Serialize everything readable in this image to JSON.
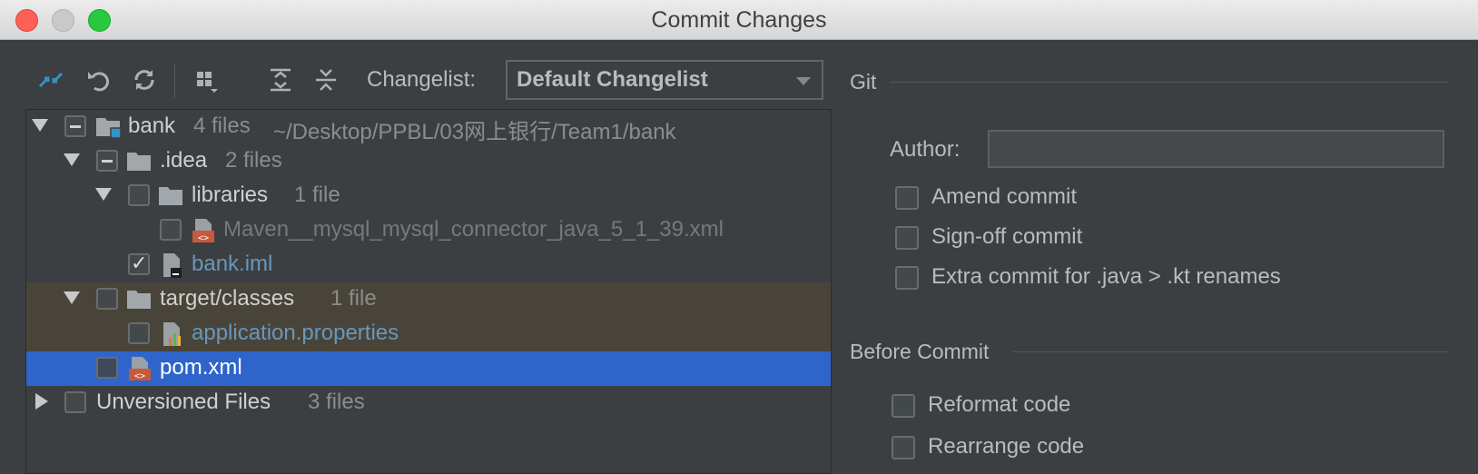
{
  "window": {
    "title": "Commit Changes"
  },
  "toolbar": {
    "icons": [
      "diff-arrows-icon",
      "undo-icon",
      "refresh-icon",
      "group-by-icon",
      "expand-all-icon",
      "collapse-all-icon"
    ],
    "changelist_label": "Changelist:",
    "changelist_value": "Default Changelist"
  },
  "tree": {
    "rows": [
      {
        "name": "bank",
        "count": "4 files",
        "path": "~/Desktop/PPBL/03网上银行/Team1/bank"
      },
      {
        "name": ".idea",
        "count": "2 files"
      },
      {
        "name": "libraries",
        "count": "1 file"
      },
      {
        "name": "Maven__mysql_mysql_connector_java_5_1_39.xml"
      },
      {
        "name": "bank.iml"
      },
      {
        "name": "target/classes",
        "count": "1 file"
      },
      {
        "name": "application.properties"
      },
      {
        "name": "pom.xml"
      },
      {
        "name": "Unversioned Files",
        "count": "3 files"
      }
    ]
  },
  "git": {
    "section_title": "Git",
    "author_label": "Author:",
    "author_value": "",
    "options": [
      "Amend commit",
      "Sign-off commit",
      "Extra commit for .java > .kt renames"
    ]
  },
  "before_commit": {
    "section_title": "Before Commit",
    "options": [
      "Reformat code",
      "Rearrange code"
    ]
  },
  "colors": {
    "selection": "#2f65ca",
    "highlight_row": "#49443a",
    "file_blue": "#6897bb",
    "background": "#3c3f41"
  }
}
